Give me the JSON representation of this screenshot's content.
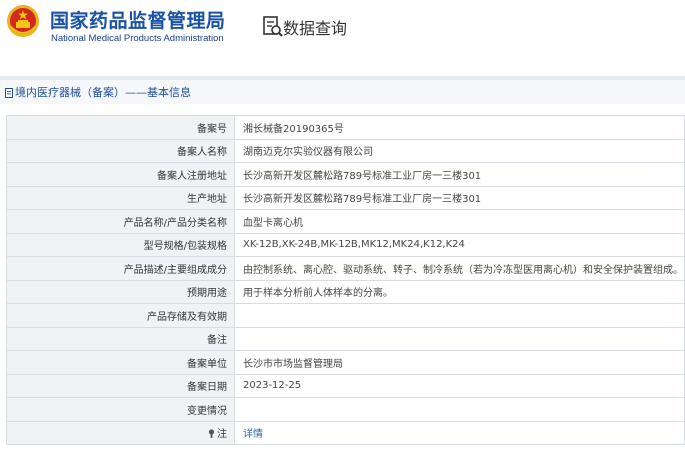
{
  "header": {
    "org_cn": "国家药品监督管理局",
    "org_en": "National Medical Products Administration",
    "db_title": "数据查询"
  },
  "breadcrumb": {
    "section": "境内医疗器械（备案）",
    "separator": "——",
    "current": "基本信息"
  },
  "colors": {
    "brand_blue": "#1a52a6",
    "emblem_red": "#d42a1e",
    "emblem_gold": "#e8b420",
    "link_blue": "#2a62b8",
    "label_bg": "#f0f2f5",
    "border": "#d9dde3"
  },
  "icons": [
    "national-emblem-icon",
    "database-search-icon",
    "document-icon",
    "note-icon"
  ],
  "rows": [
    {
      "label": "备案号",
      "value": "湘长械备20190365号"
    },
    {
      "label": "备案人名称",
      "value": "湖南迈克尔实验仪器有限公司"
    },
    {
      "label": "备案人注册地址",
      "value": "长沙高新开发区麓松路789号标准工业厂房一三楼301"
    },
    {
      "label": "生产地址",
      "value": "长沙高新开发区麓松路789号标准工业厂房一三楼301"
    },
    {
      "label": "产品名称/产品分类名称",
      "value": "血型卡离心机"
    },
    {
      "label": "型号规格/包装规格",
      "value": "XK-12B,XK-24B,MK-12B,MK12,MK24,K12,K24"
    },
    {
      "label": "产品描述/主要组成成分",
      "value": "由控制系统、离心腔、驱动系统、转子、制冷系统（若为冷冻型医用离心机）和安全保护装置组成。"
    },
    {
      "label": "预期用途",
      "value": "用于样本分析前人体样本的分离。"
    },
    {
      "label": "产品存储及有效期",
      "value": ""
    },
    {
      "label": "备注",
      "value": ""
    },
    {
      "label": "备案单位",
      "value": "长沙市市场监督管理局"
    },
    {
      "label": "备案日期",
      "value": "2023-12-25"
    },
    {
      "label": "变更情况",
      "value": ""
    },
    {
      "label": "注",
      "value": "详情"
    }
  ]
}
